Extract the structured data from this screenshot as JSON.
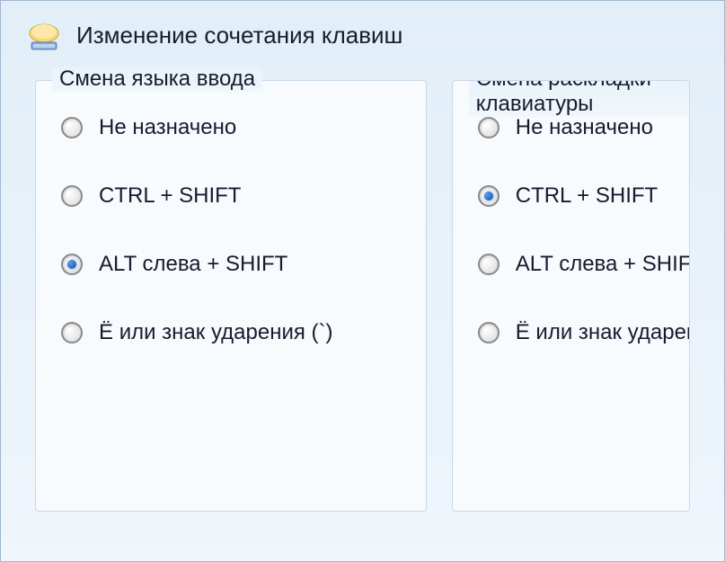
{
  "window": {
    "title": "Изменение сочетания клавиш"
  },
  "groups": {
    "inputLanguage": {
      "title": "Смена языка ввода",
      "options": [
        {
          "label": "Не назначено",
          "selected": false
        },
        {
          "label": "CTRL + SHIFT",
          "selected": false
        },
        {
          "label": "ALT слева + SHIFT",
          "selected": true
        },
        {
          "label": "Ё или знак ударения (`)",
          "selected": false
        }
      ]
    },
    "keyboardLayout": {
      "title": "Смена раскладки клавиатуры",
      "options": [
        {
          "label": "Не назначено",
          "selected": false
        },
        {
          "label": "CTRL + SHIFT",
          "selected": true
        },
        {
          "label": "ALT слева + SHIFT",
          "selected": false
        },
        {
          "label": "Ё или знак ударения (`)",
          "selected": false
        }
      ]
    }
  }
}
